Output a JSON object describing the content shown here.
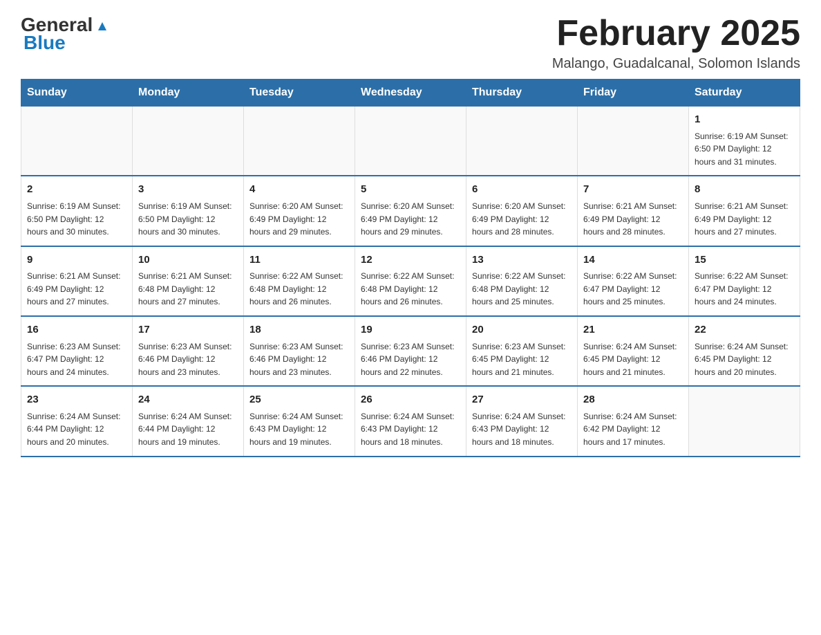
{
  "header": {
    "logo_general": "General",
    "logo_blue": "Blue",
    "title": "February 2025",
    "subtitle": "Malango, Guadalcanal, Solomon Islands"
  },
  "weekdays": [
    "Sunday",
    "Monday",
    "Tuesday",
    "Wednesday",
    "Thursday",
    "Friday",
    "Saturday"
  ],
  "weeks": [
    [
      {
        "day": "",
        "info": ""
      },
      {
        "day": "",
        "info": ""
      },
      {
        "day": "",
        "info": ""
      },
      {
        "day": "",
        "info": ""
      },
      {
        "day": "",
        "info": ""
      },
      {
        "day": "",
        "info": ""
      },
      {
        "day": "1",
        "info": "Sunrise: 6:19 AM\nSunset: 6:50 PM\nDaylight: 12 hours\nand 31 minutes."
      }
    ],
    [
      {
        "day": "2",
        "info": "Sunrise: 6:19 AM\nSunset: 6:50 PM\nDaylight: 12 hours\nand 30 minutes."
      },
      {
        "day": "3",
        "info": "Sunrise: 6:19 AM\nSunset: 6:50 PM\nDaylight: 12 hours\nand 30 minutes."
      },
      {
        "day": "4",
        "info": "Sunrise: 6:20 AM\nSunset: 6:49 PM\nDaylight: 12 hours\nand 29 minutes."
      },
      {
        "day": "5",
        "info": "Sunrise: 6:20 AM\nSunset: 6:49 PM\nDaylight: 12 hours\nand 29 minutes."
      },
      {
        "day": "6",
        "info": "Sunrise: 6:20 AM\nSunset: 6:49 PM\nDaylight: 12 hours\nand 28 minutes."
      },
      {
        "day": "7",
        "info": "Sunrise: 6:21 AM\nSunset: 6:49 PM\nDaylight: 12 hours\nand 28 minutes."
      },
      {
        "day": "8",
        "info": "Sunrise: 6:21 AM\nSunset: 6:49 PM\nDaylight: 12 hours\nand 27 minutes."
      }
    ],
    [
      {
        "day": "9",
        "info": "Sunrise: 6:21 AM\nSunset: 6:49 PM\nDaylight: 12 hours\nand 27 minutes."
      },
      {
        "day": "10",
        "info": "Sunrise: 6:21 AM\nSunset: 6:48 PM\nDaylight: 12 hours\nand 27 minutes."
      },
      {
        "day": "11",
        "info": "Sunrise: 6:22 AM\nSunset: 6:48 PM\nDaylight: 12 hours\nand 26 minutes."
      },
      {
        "day": "12",
        "info": "Sunrise: 6:22 AM\nSunset: 6:48 PM\nDaylight: 12 hours\nand 26 minutes."
      },
      {
        "day": "13",
        "info": "Sunrise: 6:22 AM\nSunset: 6:48 PM\nDaylight: 12 hours\nand 25 minutes."
      },
      {
        "day": "14",
        "info": "Sunrise: 6:22 AM\nSunset: 6:47 PM\nDaylight: 12 hours\nand 25 minutes."
      },
      {
        "day": "15",
        "info": "Sunrise: 6:22 AM\nSunset: 6:47 PM\nDaylight: 12 hours\nand 24 minutes."
      }
    ],
    [
      {
        "day": "16",
        "info": "Sunrise: 6:23 AM\nSunset: 6:47 PM\nDaylight: 12 hours\nand 24 minutes."
      },
      {
        "day": "17",
        "info": "Sunrise: 6:23 AM\nSunset: 6:46 PM\nDaylight: 12 hours\nand 23 minutes."
      },
      {
        "day": "18",
        "info": "Sunrise: 6:23 AM\nSunset: 6:46 PM\nDaylight: 12 hours\nand 23 minutes."
      },
      {
        "day": "19",
        "info": "Sunrise: 6:23 AM\nSunset: 6:46 PM\nDaylight: 12 hours\nand 22 minutes."
      },
      {
        "day": "20",
        "info": "Sunrise: 6:23 AM\nSunset: 6:45 PM\nDaylight: 12 hours\nand 21 minutes."
      },
      {
        "day": "21",
        "info": "Sunrise: 6:24 AM\nSunset: 6:45 PM\nDaylight: 12 hours\nand 21 minutes."
      },
      {
        "day": "22",
        "info": "Sunrise: 6:24 AM\nSunset: 6:45 PM\nDaylight: 12 hours\nand 20 minutes."
      }
    ],
    [
      {
        "day": "23",
        "info": "Sunrise: 6:24 AM\nSunset: 6:44 PM\nDaylight: 12 hours\nand 20 minutes."
      },
      {
        "day": "24",
        "info": "Sunrise: 6:24 AM\nSunset: 6:44 PM\nDaylight: 12 hours\nand 19 minutes."
      },
      {
        "day": "25",
        "info": "Sunrise: 6:24 AM\nSunset: 6:43 PM\nDaylight: 12 hours\nand 19 minutes."
      },
      {
        "day": "26",
        "info": "Sunrise: 6:24 AM\nSunset: 6:43 PM\nDaylight: 12 hours\nand 18 minutes."
      },
      {
        "day": "27",
        "info": "Sunrise: 6:24 AM\nSunset: 6:43 PM\nDaylight: 12 hours\nand 18 minutes."
      },
      {
        "day": "28",
        "info": "Sunrise: 6:24 AM\nSunset: 6:42 PM\nDaylight: 12 hours\nand 17 minutes."
      },
      {
        "day": "",
        "info": ""
      }
    ]
  ]
}
